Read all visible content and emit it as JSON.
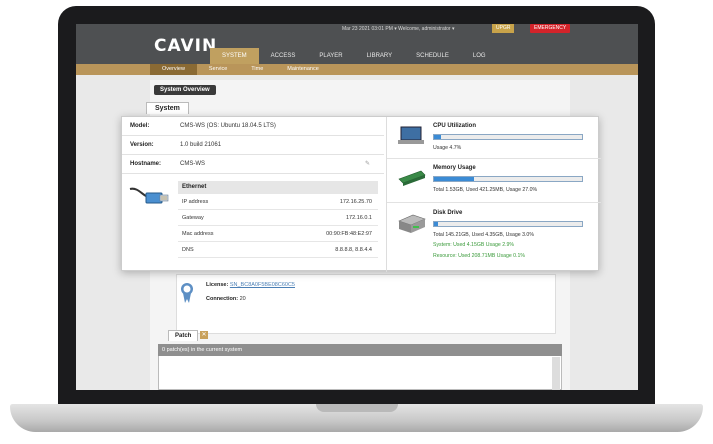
{
  "header": {
    "logo": "CAVIN",
    "date_info": "Mar 23 2021 03:01 PM ▾    Welcome, administrator ▾",
    "upgrade_label": "UPGR",
    "emergency_label": "EMERGENCY",
    "nav": [
      "SYSTEM",
      "ACCESS",
      "PLAYER",
      "LIBRARY",
      "SCHEDULE",
      "LOG"
    ],
    "active_nav": "SYSTEM"
  },
  "subnav": {
    "items": [
      "Overview",
      "Service",
      "Time",
      "Maintenance"
    ],
    "active": "Overview"
  },
  "page": {
    "section_title": "System Overview",
    "tab": "System"
  },
  "system": {
    "model_label": "Model:",
    "model_value": "CMS-WS (OS: Ubuntu 18.04.5 LTS)",
    "version_label": "Version:",
    "version_value": "1.0 build 21061",
    "hostname_label": "Hostname:",
    "hostname_value": "CMS-WS"
  },
  "ethernet": {
    "title": "Ethernet",
    "rows": [
      {
        "k": "IP address",
        "v": "172.16.25.70"
      },
      {
        "k": "Gateway",
        "v": "172.16.0.1"
      },
      {
        "k": "Mac address",
        "v": "00:90:FB:48:E2:97"
      },
      {
        "k": "DNS",
        "v": "8.8.8.8, 8.8.4.4"
      }
    ]
  },
  "resources": {
    "cpu": {
      "title": "CPU Utilization",
      "text": "Usage 4.7%",
      "percent": 4.7
    },
    "memory": {
      "title": "Memory Usage",
      "text": "Total 1.53GB, Used 421.25MB, Usage 27.0%",
      "percent": 27.0
    },
    "disk": {
      "title": "Disk Drive",
      "text": "Total 145.21GB, Used 4.35GB, Usage 3.0%",
      "system_text": "System: Used 4.15GB Usage 2.9%",
      "resource_text": "Resource: Used 208.71MB Usage 0.1%",
      "percent": 3.0
    }
  },
  "license": {
    "license_label": "License:",
    "license_value": "SN_BC8A0F5BE08C60C5",
    "connection_label": "Connection:",
    "connection_value": "20"
  },
  "patch": {
    "tab": "Patch",
    "header": "0 patch(es) in the current system"
  },
  "colors": {
    "accent": "#c0a060",
    "bar_fill": "#3b8bd5",
    "header": "#4e5052"
  }
}
